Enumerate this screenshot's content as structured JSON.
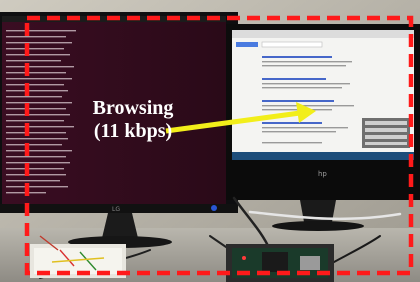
{
  "annotation": {
    "line1": "Browsing",
    "line2": "(11 kbps)",
    "text_color": "#ffffff",
    "box_color": "#ff1a1a",
    "arrow_color": "#f2ee1a"
  },
  "scene": {
    "left_monitor_brand": "LG",
    "right_monitor_brand": "hp"
  }
}
